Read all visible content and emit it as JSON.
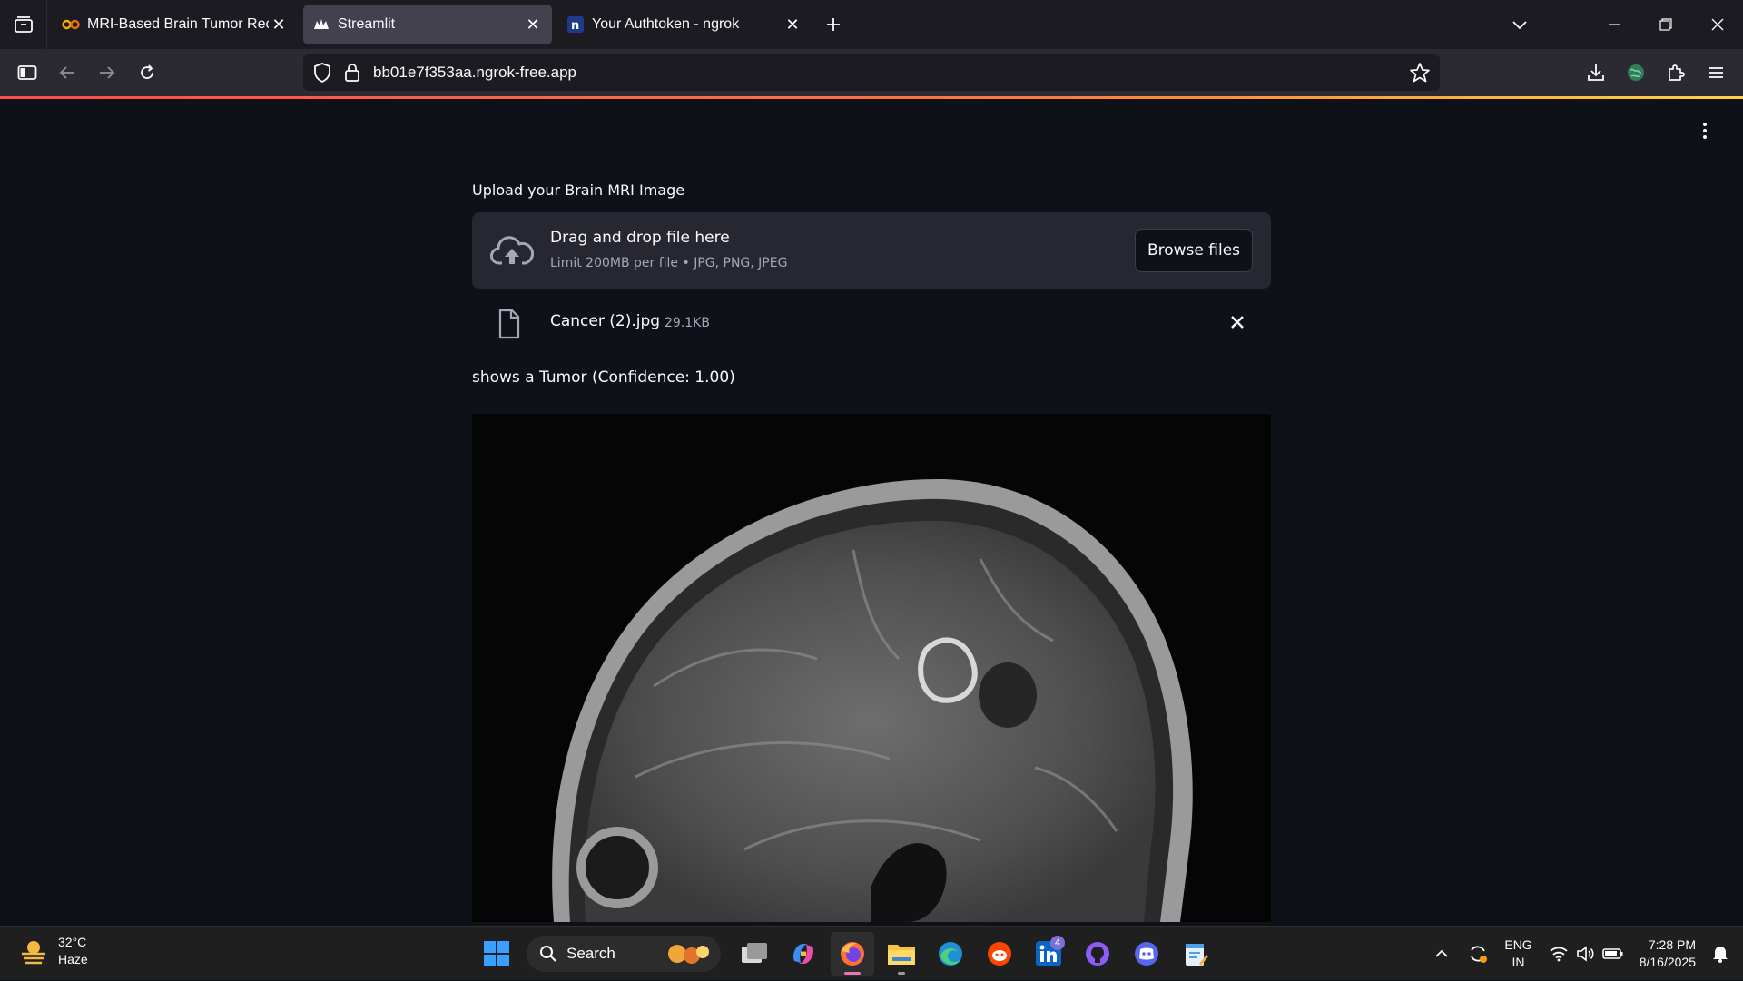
{
  "browser": {
    "tabs": [
      {
        "title": "MRI-Based Brain Tumor Recogn",
        "active": false
      },
      {
        "title": "Streamlit",
        "active": true
      },
      {
        "title": "Your Authtoken - ngrok",
        "active": false
      }
    ],
    "url": "bb01e7f353aa.ngrok-free.app"
  },
  "app": {
    "upload_label": "Upload your Brain MRI Image",
    "dropzone_title": "Drag and drop file here",
    "dropzone_subtitle": "Limit 200MB per file • JPG, PNG, JPEG",
    "browse_label": "Browse files",
    "file_name": "Cancer (2).jpg",
    "file_size": "29.1KB",
    "result": "shows a Tumor (Confidence: 1.00)"
  },
  "taskbar": {
    "temperature": "32°C",
    "weather": "Haze",
    "search_label": "Search",
    "linkedin_badge": "4",
    "lang_line1": "ENG",
    "lang_line2": "IN",
    "time": "7:28 PM",
    "date": "8/16/2025"
  },
  "colors": {
    "app_bg": "#0e1117",
    "dropzone_bg": "#262730",
    "accent": "#ff4b4b"
  }
}
